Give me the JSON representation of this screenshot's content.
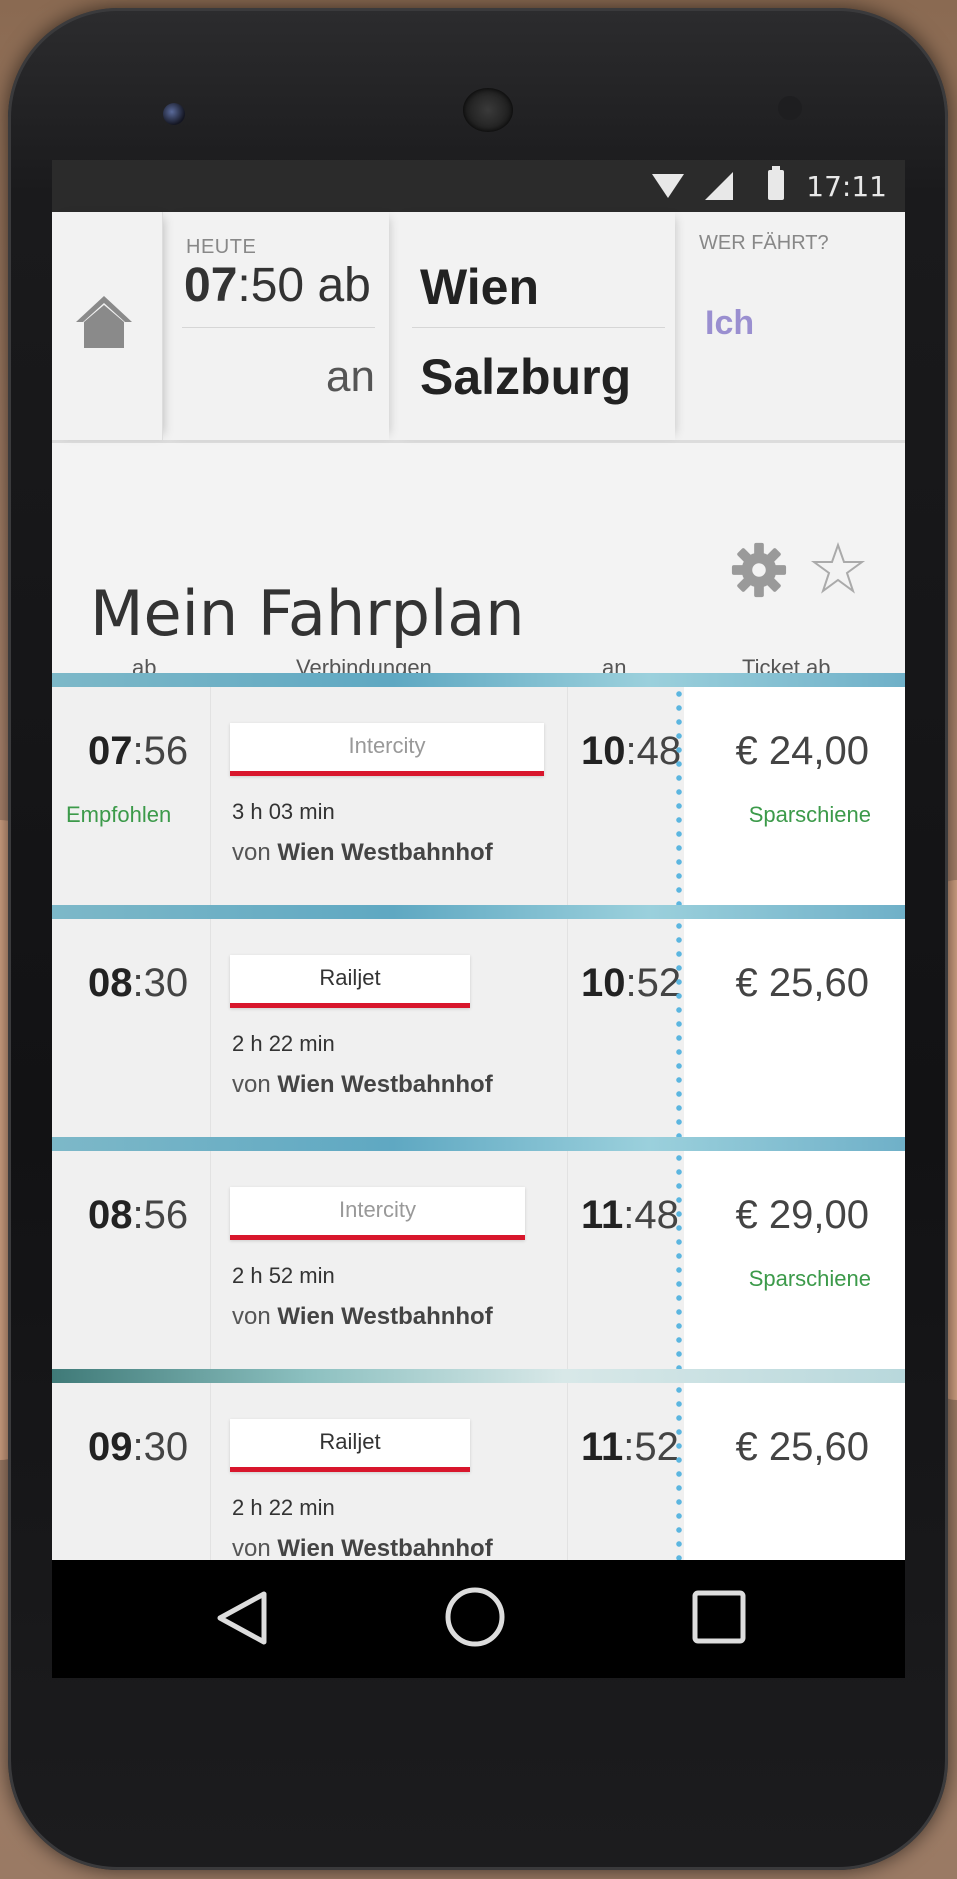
{
  "status_bar": {
    "time": "17:11"
  },
  "header": {
    "today_label": "HEUTE",
    "departure_time_hours": "07",
    "departure_time_rest": ":50 ab",
    "arrival_label": "an",
    "from_station": "Wien",
    "to_station": "Salzburg",
    "who_label": "WER FÄHRT?",
    "who_value": "Ich"
  },
  "timetable": {
    "title": "Mein Fahrplan",
    "columns": {
      "departure": "ab",
      "connections": "Verbindungen",
      "arrival": "an",
      "ticket": "Ticket ab"
    },
    "rows": [
      {
        "dep_h": "07",
        "dep_m": ":56",
        "recommended": "Empfohlen",
        "train": "Intercity",
        "duration": "3 h 03 min",
        "from_prefix": "von",
        "from_station": "Wien Westbahnhof",
        "arr_h": "10",
        "arr_m": ":48",
        "price": "€ 24,00",
        "fare": "Sparschiene"
      },
      {
        "dep_h": "08",
        "dep_m": ":30",
        "recommended": "",
        "train": "Railjet",
        "duration": "2 h 22 min",
        "from_prefix": "von",
        "from_station": "Wien Westbahnhof",
        "arr_h": "10",
        "arr_m": ":52",
        "price": "€ 25,60",
        "fare": ""
      },
      {
        "dep_h": "08",
        "dep_m": ":56",
        "recommended": "",
        "train": "Intercity",
        "duration": "2 h 52 min",
        "from_prefix": "von",
        "from_station": "Wien Westbahnhof",
        "arr_h": "11",
        "arr_m": ":48",
        "price": "€ 29,00",
        "fare": "Sparschiene"
      },
      {
        "dep_h": "09",
        "dep_m": ":30",
        "recommended": "",
        "train": "Railjet",
        "duration": "2 h 22 min",
        "from_prefix": "von",
        "from_station": "Wien Westbahnhof",
        "arr_h": "11",
        "arr_m": ":52",
        "price": "€ 25,60",
        "fare": ""
      }
    ]
  },
  "colors": {
    "accent_line": "#d8162c",
    "recommended_green": "#3c9a4a",
    "who_purple": "#9a8fd0",
    "separator_blue": "#5fa8c2",
    "dotted_blue": "#5cb6e0"
  },
  "icons": {
    "home": "home-icon",
    "settings": "gear-icon",
    "favorite": "star-icon",
    "nav_back": "back-triangle-icon",
    "nav_home": "circle-home-icon",
    "nav_recent": "square-recent-icon"
  }
}
